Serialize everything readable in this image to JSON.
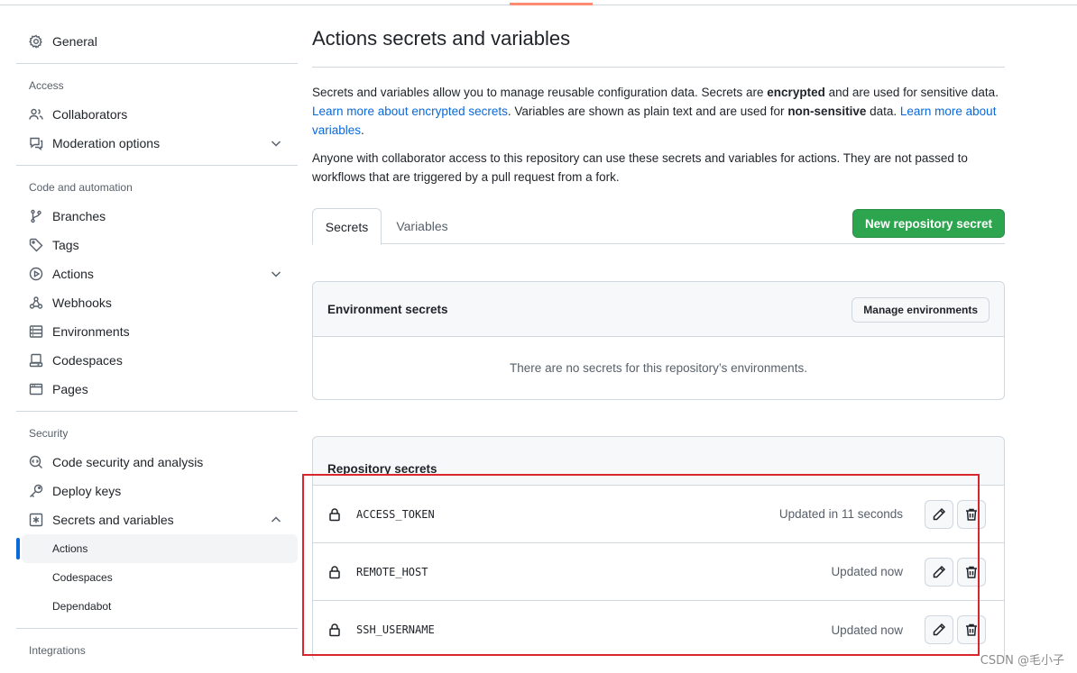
{
  "sidebar": {
    "general": "General",
    "access_title": "Access",
    "access_items": [
      {
        "label": "Collaborators",
        "icon": "people-icon"
      },
      {
        "label": "Moderation options",
        "icon": "comment-icon"
      }
    ],
    "code_title": "Code and automation",
    "code_items": [
      {
        "label": "Branches",
        "icon": "branch-icon"
      },
      {
        "label": "Tags",
        "icon": "tag-icon"
      },
      {
        "label": "Actions",
        "icon": "play-icon"
      },
      {
        "label": "Webhooks",
        "icon": "webhook-icon"
      },
      {
        "label": "Environments",
        "icon": "server-icon"
      },
      {
        "label": "Codespaces",
        "icon": "codespaces-icon"
      },
      {
        "label": "Pages",
        "icon": "browser-icon"
      }
    ],
    "security_title": "Security",
    "security_items": [
      {
        "label": "Code security and analysis",
        "icon": "codescan-icon"
      },
      {
        "label": "Deploy keys",
        "icon": "key-icon"
      },
      {
        "label": "Secrets and variables",
        "icon": "asterisk-icon"
      }
    ],
    "secrets_sub": [
      "Actions",
      "Codespaces",
      "Dependabot"
    ],
    "integrations_title": "Integrations"
  },
  "main": {
    "title": "Actions secrets and variables",
    "desc": {
      "p1_a": "Secrets and variables allow you to manage reusable configuration data. Secrets are ",
      "p1_b": "encrypted",
      "p1_c": " and are used for sensitive data. ",
      "link1": "Learn more about encrypted secrets",
      "p1_d": ". Variables are shown as plain text and are used for ",
      "p1_e": "non-sensitive",
      "p1_f": " data. ",
      "link2": "Learn more about variables",
      "p1_g": ".",
      "p2": "Anyone with collaborator access to this repository can use these secrets and variables for actions. They are not passed to workflows that are triggered by a pull request from a fork."
    },
    "tabs": [
      "Secrets",
      "Variables"
    ],
    "new_secret_button": "New repository secret",
    "env_box": {
      "title": "Environment secrets",
      "manage_button": "Manage environments",
      "empty": "There are no secrets for this repository’s environments."
    },
    "repo_box": {
      "title": "Repository secrets",
      "secrets": [
        {
          "name": "ACCESS_TOKEN",
          "updated": "Updated in 11 seconds"
        },
        {
          "name": "REMOTE_HOST",
          "updated": "Updated now"
        },
        {
          "name": "SSH_USERNAME",
          "updated": "Updated now"
        }
      ]
    }
  },
  "watermark": "CSDN @毛小子",
  "colors": {
    "accent": "#0969da",
    "primary_button": "#2da44e",
    "highlight_box": "#d9262c"
  }
}
